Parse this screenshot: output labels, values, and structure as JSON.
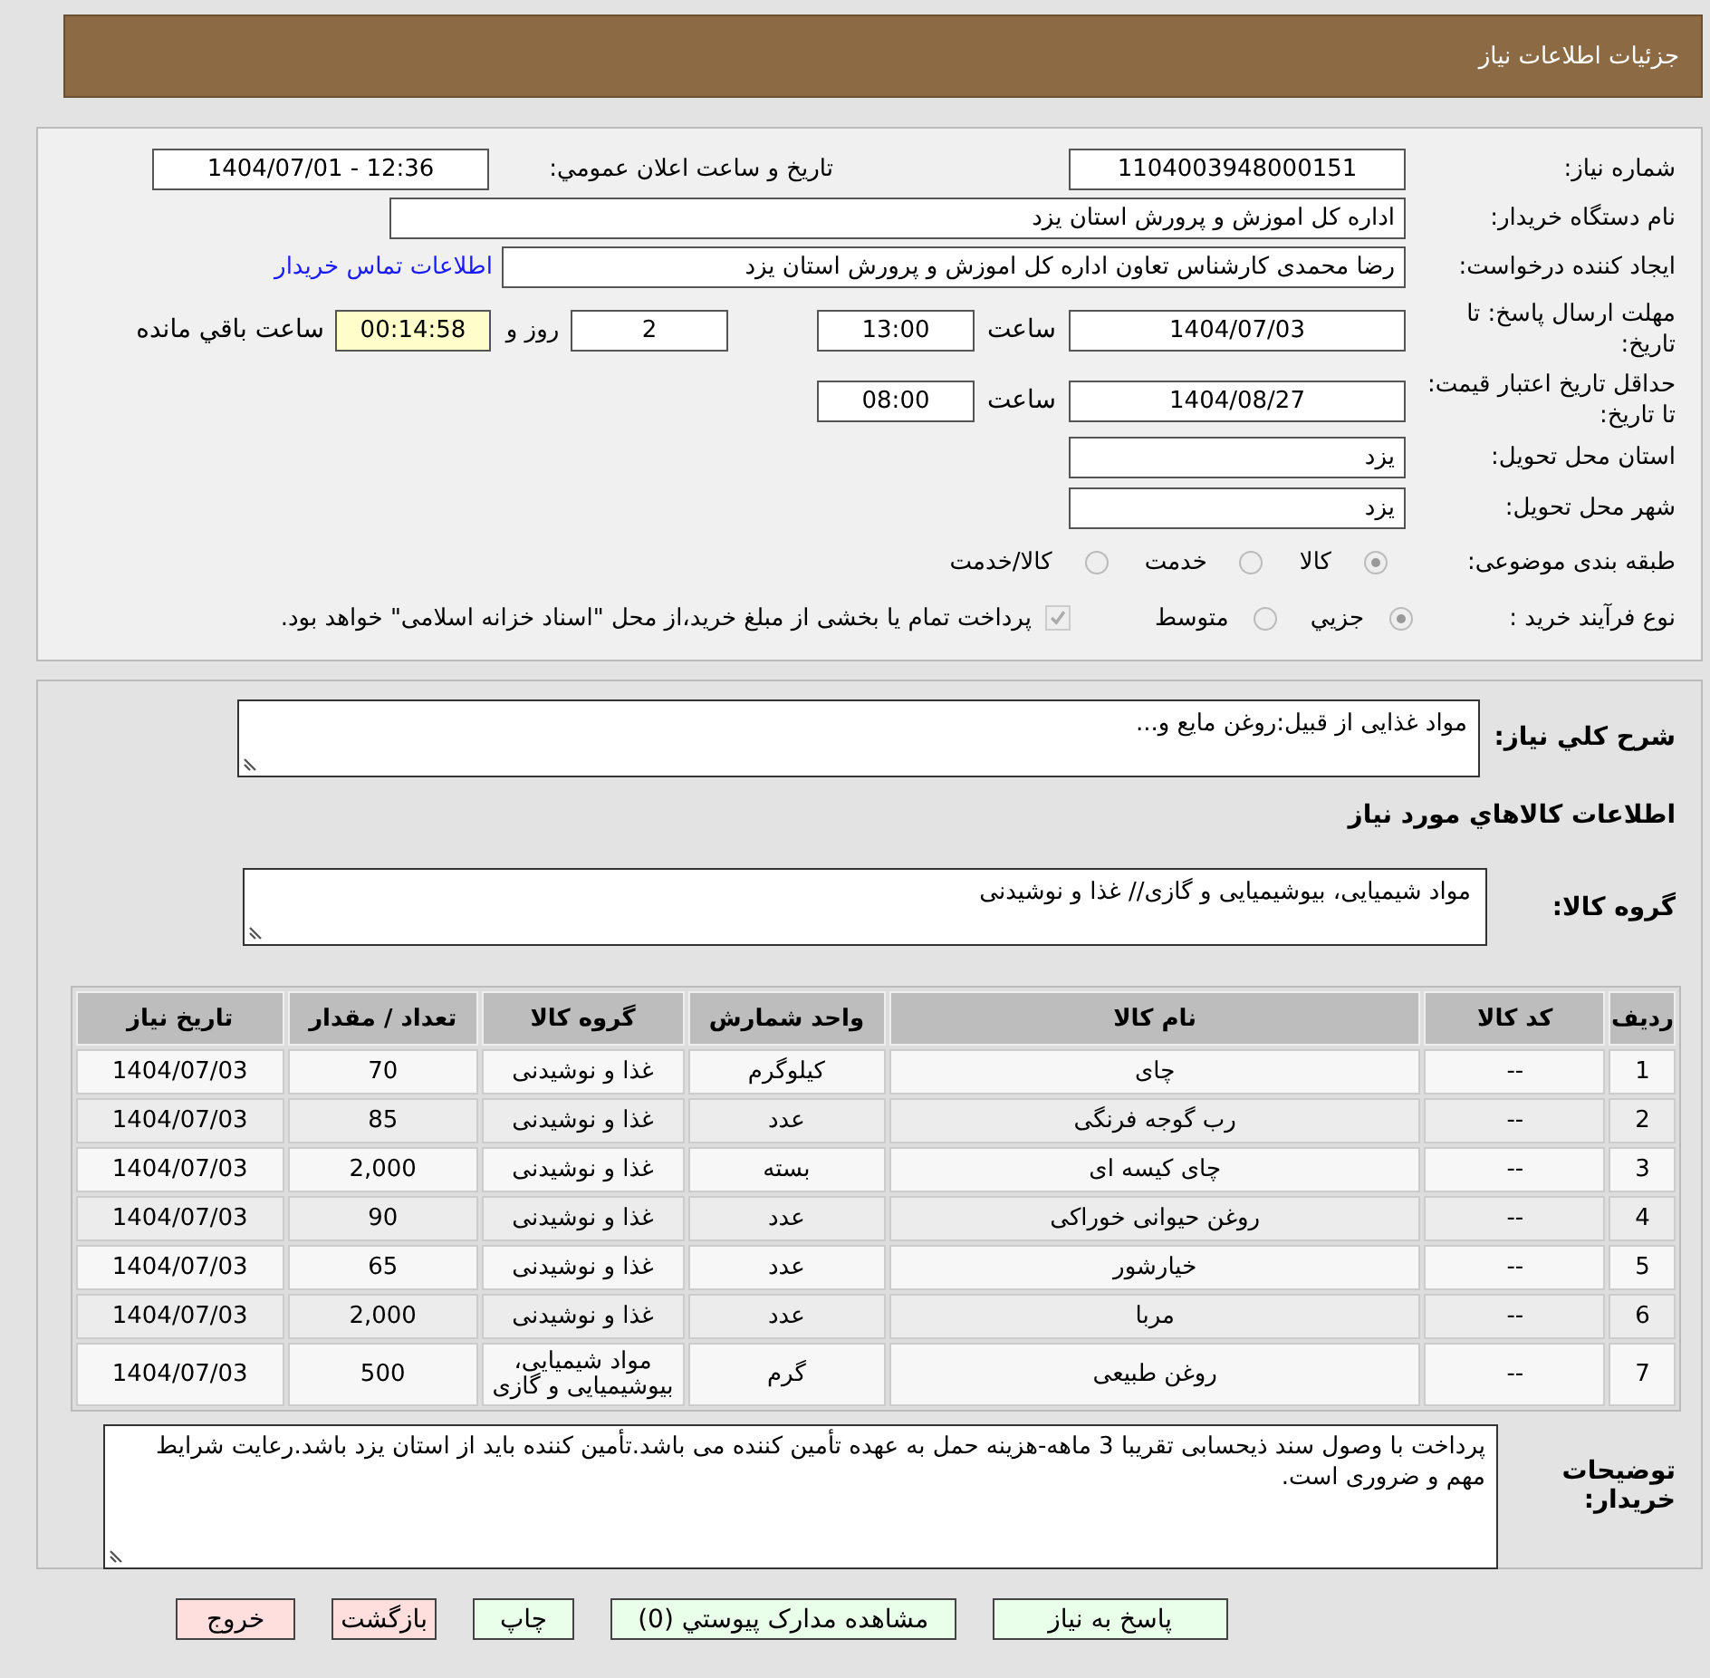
{
  "header": {
    "title": "جزئیات اطلاعات نیاز"
  },
  "need_number": {
    "label": "شماره نیاز:",
    "value": "1104003948000151"
  },
  "announce": {
    "label": "تاریخ و ساعت اعلان عمومي:",
    "value": "1404/07/01 - 12:36"
  },
  "buyer_org": {
    "label": "نام دستگاه خریدار:",
    "value": "اداره کل اموزش و پرورش استان یزد"
  },
  "requester": {
    "label": "ایجاد کننده درخواست:",
    "value": "رضا محمدی کارشناس تعاون اداره کل اموزش و پرورش استان یزد",
    "link": "اطلاعات تماس خریدار"
  },
  "reply_deadline": {
    "label": "مهلت ارسال پاسخ: تا تاریخ:",
    "date": "1404/07/03",
    "time_label": "ساعت",
    "time": "13:00",
    "days": "2",
    "days_label": "روز و",
    "remaining": "00:14:58",
    "remaining_label": "ساعت باقي مانده"
  },
  "price_validity": {
    "label": "حداقل تاریخ اعتبار قیمت: تا تاریخ:",
    "date": "1404/08/27",
    "time_label": "ساعت",
    "time": "08:00"
  },
  "province": {
    "label": "استان محل تحویل:",
    "value": "یزد"
  },
  "city": {
    "label": "شهر محل تحویل:",
    "value": "یزد"
  },
  "category": {
    "label": "طبقه بندی موضوعی:",
    "options": [
      {
        "label": "کالا",
        "selected": true
      },
      {
        "label": "خدمت",
        "selected": false
      },
      {
        "label": "کالا/خدمت",
        "selected": false
      }
    ]
  },
  "process": {
    "label": "نوع فرآیند خرید :",
    "options": [
      {
        "label": "جزيي",
        "selected": true
      },
      {
        "label": "متوسط",
        "selected": false
      }
    ],
    "payment": {
      "checked": true,
      "text": "پرداخت تمام یا بخشی از مبلغ خرید،از محل \"اسناد خزانه اسلامی\" خواهد بود."
    }
  },
  "summary": {
    "label": "شرح کلي نیاز:",
    "value": "مواد غذایی از قبیل:روغن مایع و..."
  },
  "goods_heading": "اطلاعات کالاهاي مورد نیاز",
  "goods_group": {
    "label": "گروه کالا:",
    "value": "مواد شیمیایی، بیوشیمیایی و  گازی// غذا و نوشیدنی"
  },
  "table": {
    "columns": [
      "ردیف",
      "کد کالا",
      "نام کالا",
      "واحد شمارش",
      "گروه کالا",
      "تعداد / مقدار",
      "تاریخ نیاز"
    ],
    "rows": [
      [
        "1",
        "--",
        "چای",
        "کیلوگرم",
        "غذا و نوشیدنی",
        "70",
        "1404/07/03"
      ],
      [
        "2",
        "--",
        "رب گوجه فرنگی",
        "عدد",
        "غذا و نوشیدنی",
        "85",
        "1404/07/03"
      ],
      [
        "3",
        "--",
        "چای کیسه ای",
        "بسته",
        "غذا و نوشیدنی",
        "2,000",
        "1404/07/03"
      ],
      [
        "4",
        "--",
        "روغن حیوانی خوراکی",
        "عدد",
        "غذا و نوشیدنی",
        "90",
        "1404/07/03"
      ],
      [
        "5",
        "--",
        "خیارشور",
        "عدد",
        "غذا و نوشیدنی",
        "65",
        "1404/07/03"
      ],
      [
        "6",
        "--",
        "مربا",
        "عدد",
        "غذا و نوشیدنی",
        "2,000",
        "1404/07/03"
      ],
      [
        "7",
        "--",
        "روغن طبیعی",
        "گرم",
        "مواد شیمیایی، بیوشیمیایی و گازی",
        "500",
        "1404/07/03"
      ]
    ]
  },
  "buyer_notes": {
    "label": "توضیحات خریدار:",
    "value": "پرداخت با وصول سند ذیحسابی تقریبا 3 ماهه-هزینه حمل به عهده تأمین کننده می باشد.تأمین کننده باید از استان یزد باشد.رعایت شرایط مهم و ضروری است."
  },
  "buttons": [
    {
      "label": "پاسخ به نیاز",
      "kind": "action"
    },
    {
      "label": "مشاهده مدارک پیوستي (0)",
      "kind": "action"
    },
    {
      "label": "چاپ",
      "kind": "action"
    },
    {
      "label": "بازگشت",
      "kind": "exit"
    },
    {
      "label": "خروج",
      "kind": "exit"
    }
  ]
}
